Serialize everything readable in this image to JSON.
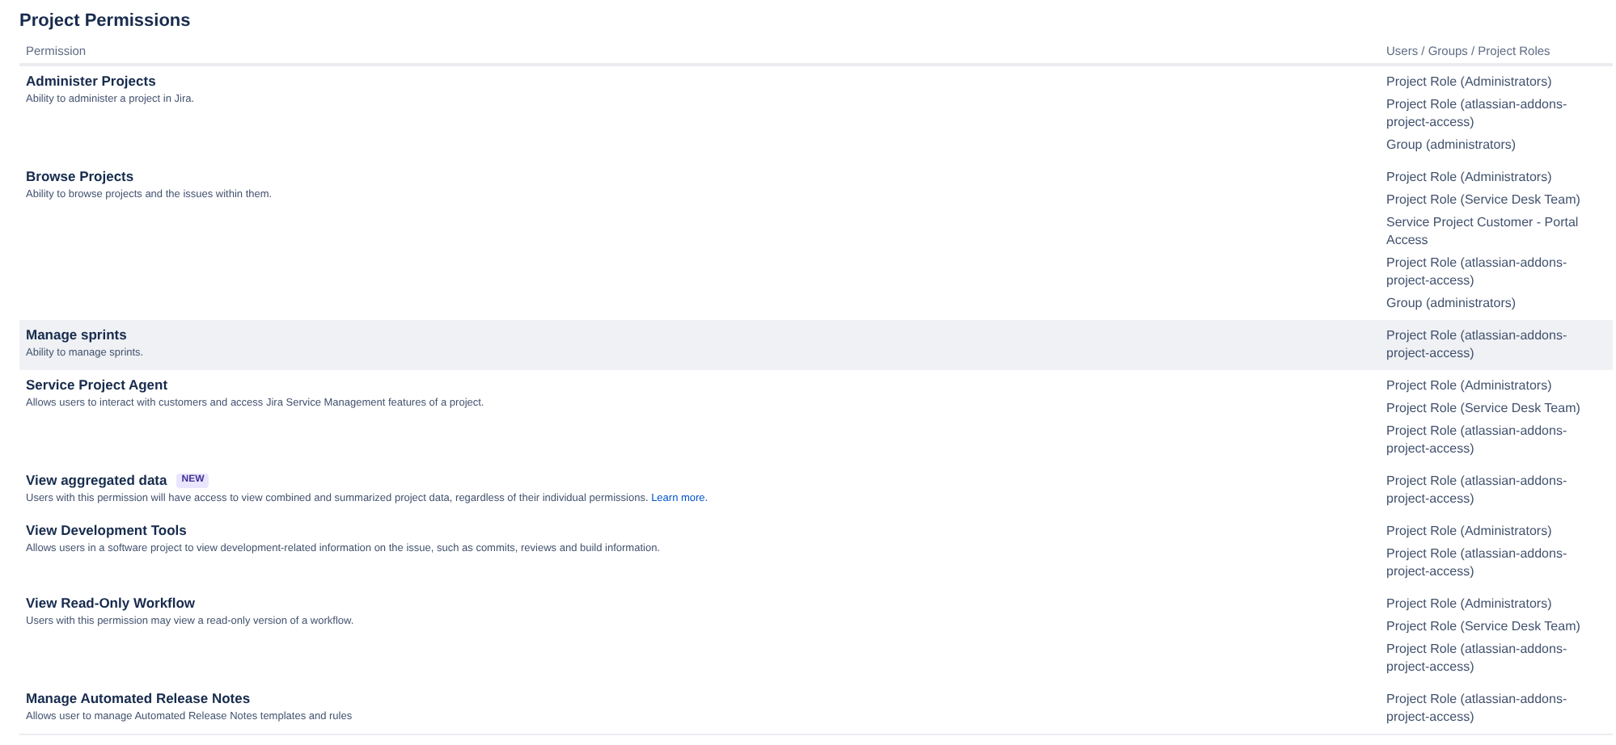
{
  "title": "Project Permissions",
  "table": {
    "columns": [
      "Permission",
      "Users / Groups / Project Roles"
    ],
    "rows": [
      {
        "name": "Administer Projects",
        "description": "Ability to administer a project in Jira.",
        "highlighted": false,
        "roles": [
          "Project Role (Administrators)",
          "Project Role (atlassian-addons-project-access)",
          "Group (administrators)"
        ]
      },
      {
        "name": "Browse Projects",
        "description": "Ability to browse projects and the issues within them.",
        "highlighted": false,
        "roles": [
          "Project Role (Administrators)",
          "Project Role (Service Desk Team)",
          "Service Project Customer - Portal Access",
          "Project Role (atlassian-addons-project-access)",
          "Group (administrators)"
        ]
      },
      {
        "name": "Manage sprints",
        "description": "Ability to manage sprints.",
        "highlighted": true,
        "roles": [
          "Project Role (atlassian-addons-project-access)"
        ]
      },
      {
        "name": "Service Project Agent",
        "description": "Allows users to interact with customers and access Jira Service Management features of a project.",
        "highlighted": false,
        "roles": [
          "Project Role (Administrators)",
          "Project Role (Service Desk Team)",
          "Project Role (atlassian-addons-project-access)"
        ]
      },
      {
        "name": "View aggregated data",
        "badge": "NEW",
        "description": "Users with this permission will have access to view combined and summarized project data, regardless of their individual permissions.",
        "link": "Learn more.",
        "highlighted": false,
        "roles": [
          "Project Role (atlassian-addons-project-access)"
        ]
      },
      {
        "name": "View Development Tools",
        "description": "Allows users in a software project to view development-related information on the issue, such as commits, reviews and build information.",
        "highlighted": false,
        "roles": [
          "Project Role (Administrators)",
          "Project Role (atlassian-addons-project-access)"
        ]
      },
      {
        "name": "View Read-Only Workflow",
        "description": "Users with this permission may view a read-only version of a workflow.",
        "highlighted": false,
        "roles": [
          "Project Role (Administrators)",
          "Project Role (Service Desk Team)",
          "Project Role (atlassian-addons-project-access)"
        ]
      },
      {
        "name": "Manage Automated Release Notes",
        "description": "Allows user to manage Automated Release Notes templates and rules",
        "highlighted": false,
        "roles": [
          "Project Role (atlassian-addons-project-access)"
        ]
      }
    ]
  }
}
